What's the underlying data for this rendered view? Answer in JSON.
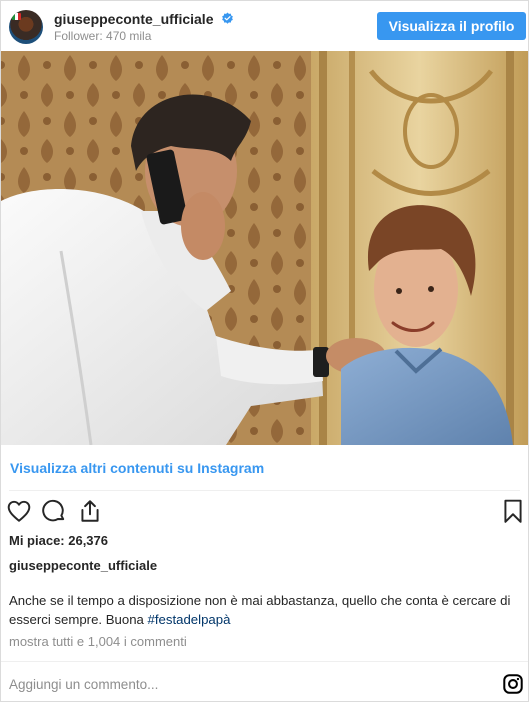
{
  "header": {
    "username": "giuseppeconte_ufficiale",
    "followers": "Follower: 470 mila",
    "profile_button": "Visualizza il profilo"
  },
  "links": {
    "more_content": "Visualizza altri contenuti su Instagram"
  },
  "post": {
    "likes": "Mi piace: 26,376",
    "owner": "giuseppeconte_ufficiale",
    "caption_text": "Anche se il tempo a disposizione non è mai abbastanza, quello che conta è cercare di esserci sempre. Buona ",
    "hashtag": "#festadelpapà",
    "comments_link": "mostra tutti e 1,004 i commenti"
  },
  "comment_box": {
    "placeholder": "Aggiungi un commento..."
  },
  "icons": [
    "verified-badge-icon",
    "heart-icon",
    "comment-icon",
    "share-icon",
    "bookmark-icon",
    "instagram-logo-icon"
  ],
  "colors": {
    "accent": "#3897f0",
    "hashtag": "#003569",
    "muted": "#8e8e8e",
    "text": "#262626"
  }
}
